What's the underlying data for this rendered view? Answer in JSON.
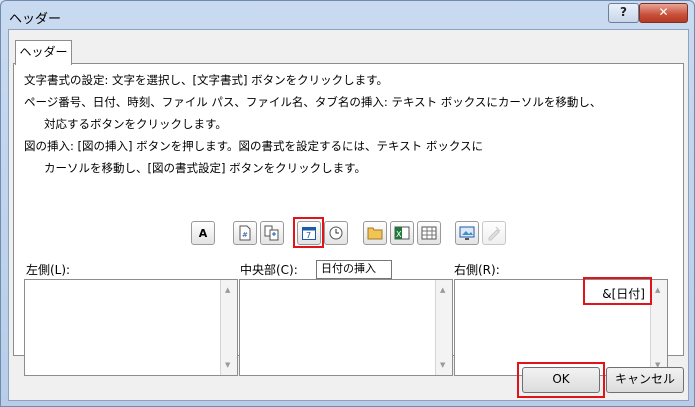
{
  "dialog": {
    "title": "ヘッダー",
    "help_label": "?",
    "close_label": "✕"
  },
  "tab": {
    "label": "ヘッダー"
  },
  "instructions": [
    "文字書式の設定: 文字を選択し、[文字書式] ボタンをクリックします。",
    "ページ番号、日付、時刻、ファイル パス、ファイル名、タブ名の挿入: テキスト ボックスにカーソルを移動し、",
    "対応するボタンをクリックします。",
    "図の挿入: [図の挿入] ボタンを押します。図の書式を設定するには、テキスト ボックスに",
    "カーソルを移動し、[図の書式設定] ボタンをクリックします。"
  ],
  "toolbar": {
    "format_text_label": "A",
    "tooltip": "日付の挿入",
    "icons": [
      "font-icon",
      "page-number-icon",
      "page-count-icon",
      "calendar-icon",
      "clock-icon",
      "folder-icon",
      "excel-icon",
      "sheet-icon",
      "picture-icon",
      "format-picture-icon"
    ]
  },
  "sections": {
    "left_label": "左側(L):",
    "center_label": "中央部(C):",
    "right_label": "右側(R):",
    "left_value": "",
    "center_value": "",
    "right_value": "&[日付]"
  },
  "buttons": {
    "ok_label": "OK",
    "cancel_label": "キャンセル"
  },
  "colors": {
    "highlight": "#e1141c"
  }
}
